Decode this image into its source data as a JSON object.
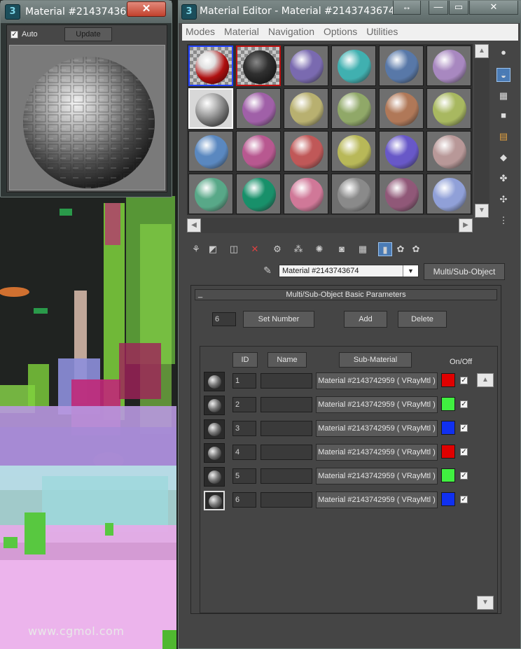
{
  "preview_window": {
    "title": "Material #21437436...",
    "close_label": "✕",
    "auto_label": "Auto",
    "auto_checked": true,
    "update_label": "Update"
  },
  "editor": {
    "title": "Material Editor - Material #2143743674",
    "app_icon_label": "3",
    "controls": {
      "resize": "↔",
      "minimize": "—",
      "maximize": "▭",
      "close": "✕"
    },
    "menu": [
      "Modes",
      "Material",
      "Navigation",
      "Options",
      "Utilities"
    ],
    "slots": [
      {
        "color": "#c0c0c0",
        "style": "checker-red"
      },
      {
        "color": "#202020",
        "style": "dark-sparkle"
      },
      {
        "color": "#7a6ab0"
      },
      {
        "color": "#40b0b0"
      },
      {
        "color": "#5878a8"
      },
      {
        "color": "#a888c0"
      },
      {
        "color": "#9a9a9a",
        "style": "metal"
      },
      {
        "color": "#a060a8"
      },
      {
        "color": "#b8b070"
      },
      {
        "color": "#90a868"
      },
      {
        "color": "#b07858"
      },
      {
        "color": "#a8b860"
      },
      {
        "color": "#5a88c0"
      },
      {
        "color": "#b85890"
      },
      {
        "color": "#c05858"
      },
      {
        "color": "#b8b858"
      },
      {
        "color": "#6858c8"
      },
      {
        "color": "#b89898"
      },
      {
        "color": "#58a888"
      },
      {
        "color": "#18906a"
      },
      {
        "color": "#d07898"
      },
      {
        "color": "#8a8a8a"
      },
      {
        "color": "#905878"
      },
      {
        "color": "#90a0d8"
      }
    ],
    "side_tools": [
      "sample-type-icon",
      "backlight-icon",
      "checker-background-icon",
      "sample-uv-tiling-icon",
      "video-color-check-icon",
      "make-preview-icon",
      "options-icon",
      "select-by-material-icon",
      "material-navigator-icon"
    ],
    "toolbar_tools": [
      "get-material-icon",
      "put-to-scene-icon",
      "assign-to-selection-icon",
      "delete-icon",
      "make-unique-icon",
      "put-to-library-icon",
      "material-id-channel-icon",
      "show-map-icon",
      "show-background-icon",
      "show-end-result-icon",
      "go-to-parent-icon",
      "go-forward-icon"
    ],
    "material_name": "Material #2143743674",
    "material_type_button": "Multi/Sub-Object",
    "rollout": {
      "title": "Multi/Sub-Object Basic Parameters",
      "collapse_label": "_",
      "number_value": "6",
      "set_number": "Set Number",
      "add": "Add",
      "delete": "Delete",
      "headers": {
        "id": "ID",
        "name": "Name",
        "sub_material": "Sub-Material",
        "on_off": "On/Off"
      },
      "rows": [
        {
          "id": "1",
          "name": "",
          "sub": "Material #2143742959  ( VRayMtl )",
          "color": "#e00000",
          "on": true
        },
        {
          "id": "2",
          "name": "",
          "sub": "Material #2143742959  ( VRayMtl )",
          "color": "#40f040",
          "on": true
        },
        {
          "id": "3",
          "name": "",
          "sub": "Material #2143742959  ( VRayMtl )",
          "color": "#1030f0",
          "on": true
        },
        {
          "id": "4",
          "name": "",
          "sub": "Material #2143742959  ( VRayMtl )",
          "color": "#e00000",
          "on": true
        },
        {
          "id": "5",
          "name": "",
          "sub": "Material #2143742959  ( VRayMtl )",
          "color": "#40f040",
          "on": true
        },
        {
          "id": "6",
          "name": "",
          "sub": "Material #2143742959  ( VRayMtl )",
          "color": "#1030f0",
          "on": true
        }
      ]
    }
  },
  "watermark": "www.cgmol.com"
}
